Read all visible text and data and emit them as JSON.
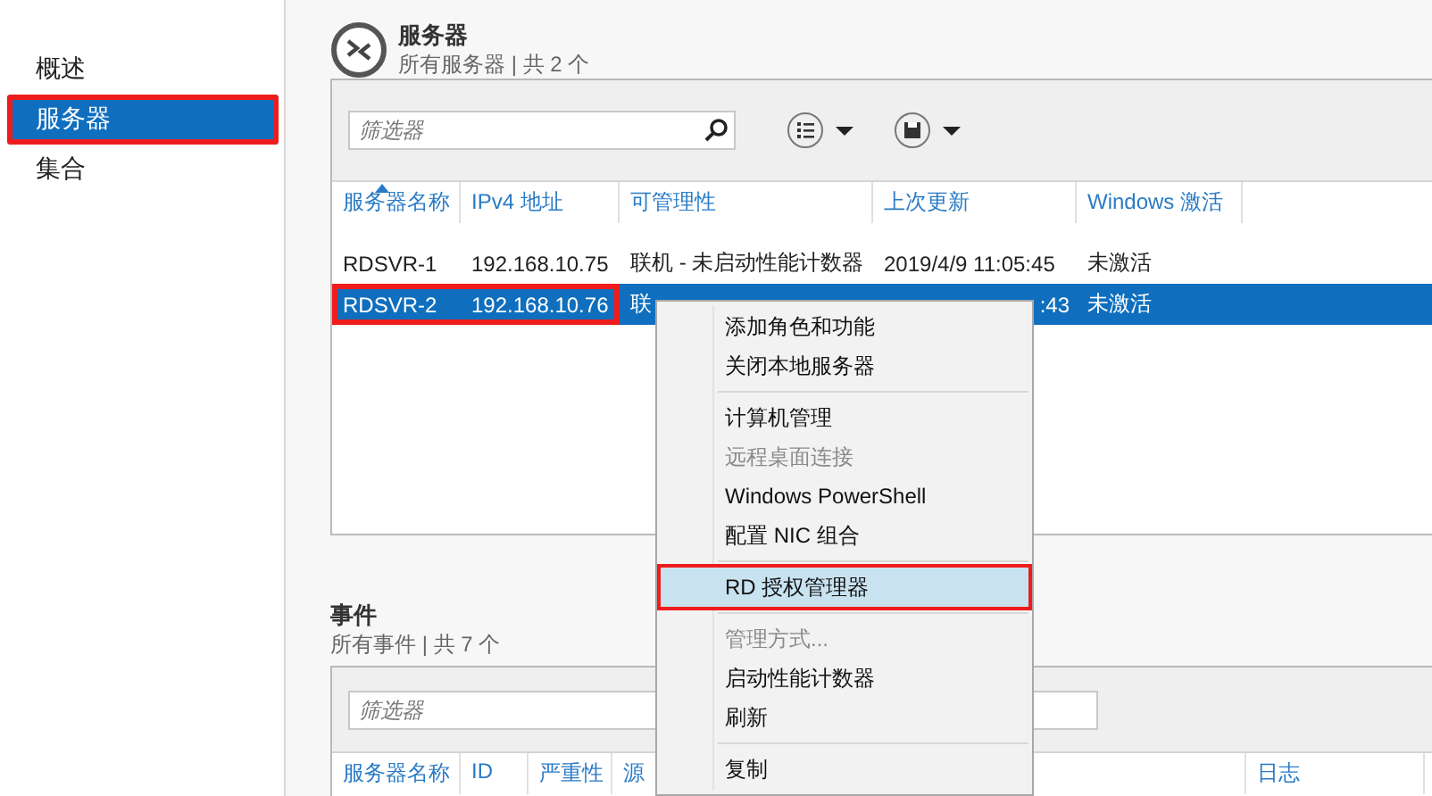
{
  "sidebar": {
    "items": [
      {
        "label": "概述",
        "selected": false,
        "highlighted": false
      },
      {
        "label": "服务器",
        "selected": true,
        "highlighted": true
      },
      {
        "label": "集合",
        "selected": false,
        "highlighted": false
      }
    ]
  },
  "servers": {
    "title": "服务器",
    "subtitle": "所有服务器 | 共 2 个",
    "filter": {
      "placeholder": "筛选器"
    },
    "columns": [
      "服务器名称",
      "IPv4 地址",
      "可管理性",
      "上次更新",
      "Windows 激活"
    ],
    "rows": [
      {
        "selected": false,
        "cells": [
          {
            "text": "RDSVR-1",
            "highlighted": false
          },
          {
            "text": "192.168.10.75",
            "highlighted": false
          },
          {
            "text": "联机 - 未启动性能计数器",
            "highlighted": false
          },
          {
            "text": "2019/4/9 11:05:45",
            "highlighted": false
          },
          {
            "text": "未激活",
            "highlighted": false
          }
        ]
      },
      {
        "selected": true,
        "cells": [
          {
            "text": "RDSVR-2",
            "highlighted": true
          },
          {
            "text": "192.168.10.76",
            "highlighted": true
          },
          {
            "text": "联",
            "highlighted": false
          },
          {
            "text": ":43",
            "highlighted": false,
            "covered_left": true
          },
          {
            "text": "未激活",
            "highlighted": false
          }
        ]
      }
    ]
  },
  "events": {
    "title": "事件",
    "subtitle": "所有事件 | 共 7 个",
    "filter": {
      "placeholder": "筛选器"
    },
    "columns": [
      "服务器名称",
      "ID",
      "严重性",
      "源",
      "日志"
    ]
  },
  "context_menu": [
    {
      "kind": "item",
      "label": "添加角色和功能",
      "disabled": false,
      "hovered": false,
      "highlighted": false
    },
    {
      "kind": "item",
      "label": "关闭本地服务器",
      "disabled": false,
      "hovered": false,
      "highlighted": false
    },
    {
      "kind": "separator"
    },
    {
      "kind": "item",
      "label": "计算机管理",
      "disabled": false,
      "hovered": false,
      "highlighted": false
    },
    {
      "kind": "item",
      "label": "远程桌面连接",
      "disabled": true,
      "hovered": false,
      "highlighted": false
    },
    {
      "kind": "item",
      "label": "Windows PowerShell",
      "disabled": false,
      "hovered": false,
      "highlighted": false
    },
    {
      "kind": "item",
      "label": "配置 NIC 组合",
      "disabled": false,
      "hovered": false,
      "highlighted": false
    },
    {
      "kind": "separator"
    },
    {
      "kind": "item",
      "label": "RD 授权管理器",
      "disabled": false,
      "hovered": true,
      "highlighted": true
    },
    {
      "kind": "separator"
    },
    {
      "kind": "item",
      "label": "管理方式...",
      "disabled": true,
      "hovered": false,
      "highlighted": false
    },
    {
      "kind": "item",
      "label": "启动性能计数器",
      "disabled": false,
      "hovered": false,
      "highlighted": false
    },
    {
      "kind": "item",
      "label": "刷新",
      "disabled": false,
      "hovered": false,
      "highlighted": false
    },
    {
      "kind": "separator"
    },
    {
      "kind": "item",
      "label": "复制",
      "disabled": false,
      "hovered": false,
      "highlighted": false
    }
  ]
}
